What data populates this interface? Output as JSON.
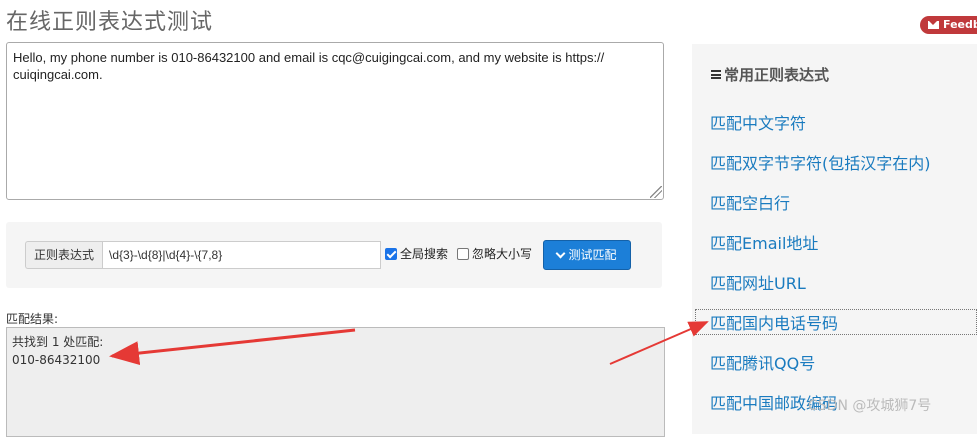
{
  "page": {
    "title": "在线正则表达式测试",
    "feedback_label": "Feedb"
  },
  "editor": {
    "text": "Hello, my phone number is 010-86432100 and email is cqc@cuigingcai.com, and my website is https:// cuiqingcai.com."
  },
  "search": {
    "addon_label": "正则表达式",
    "regex_value": "\\d{3}-\\d{8}|\\d{4}-\\{7,8}",
    "global_label": "全局搜索",
    "global_checked": true,
    "ignore_case_label": "忽略大小写",
    "ignore_case_checked": false,
    "test_button_label": "测试匹配"
  },
  "result": {
    "label": "匹配结果:",
    "summary": "共找到 1 处匹配:",
    "match": "010-86432100"
  },
  "sidebar": {
    "title": "常用正则表达式",
    "links": [
      "匹配中文字符",
      "匹配双字节字符(包括汉字在内)",
      "匹配空白行",
      "匹配Email地址",
      "匹配网址URL",
      "匹配国内电话号码",
      "匹配腾讯QQ号",
      "匹配中国邮政编码"
    ]
  },
  "watermark": "CSDN @攻城狮7号",
  "colors": {
    "link": "#1a7bbf",
    "button": "#1c7fd8",
    "annotation_arrow": "#e53935"
  }
}
